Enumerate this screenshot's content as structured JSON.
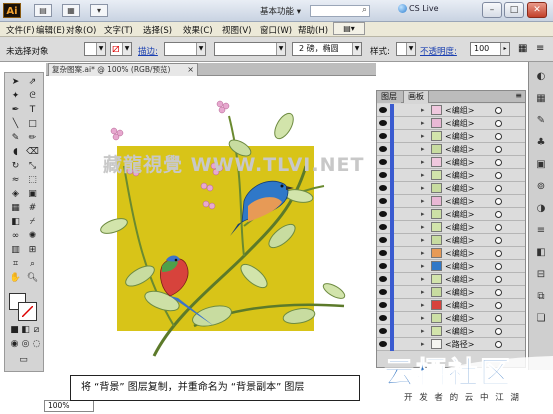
{
  "titlebar": {
    "app_logo": "Ai",
    "workspace": "基本功能",
    "cs_live": "CS Live",
    "minimize": "–",
    "maximize": "□",
    "close": "✕"
  },
  "menubar": {
    "items": [
      "文件(F)",
      "编辑(E)",
      "对象(O)",
      "文字(T)",
      "选择(S)",
      "效果(C)",
      "视图(V)",
      "窗口(W)",
      "帮助(H)"
    ]
  },
  "controlbar": {
    "selection_label": "未选择对象",
    "stroke_label": "描边:",
    "brush_value": "2 磅，椭圆",
    "style_label": "样式:",
    "opacity_label": "不透明度:",
    "opacity_value": "100"
  },
  "document": {
    "tab_title": "复杂图案.ai* @ 100% (RGB/预览)",
    "zoom": "100%"
  },
  "watermark": "藏龍視覺 WWW.TLVI.NET",
  "layers_panel": {
    "tabs": [
      "图层",
      "画板"
    ],
    "rows": [
      "<编组>",
      "<编组>",
      "<编组>",
      "<编组>",
      "<编组>",
      "<编组>",
      "<编组>",
      "<编组>",
      "<编组>",
      "<编组>",
      "<编组>",
      "<编组>",
      "<编组>",
      "<编组>",
      "<编组>",
      "<编组>",
      "<编组>",
      "<编组>",
      "<路径>"
    ]
  },
  "caption": "将 “背景” 图层复制，并重命名为 “背景副本” 图层",
  "site_logo": {
    "name": "云栖社区",
    "tagline": "开 发 者 的 云 中 江 湖"
  },
  "colors": {
    "artboard": "#d8c418",
    "selection_blue": "#3a5bd0",
    "logo_blue": "#2a6fc0"
  }
}
